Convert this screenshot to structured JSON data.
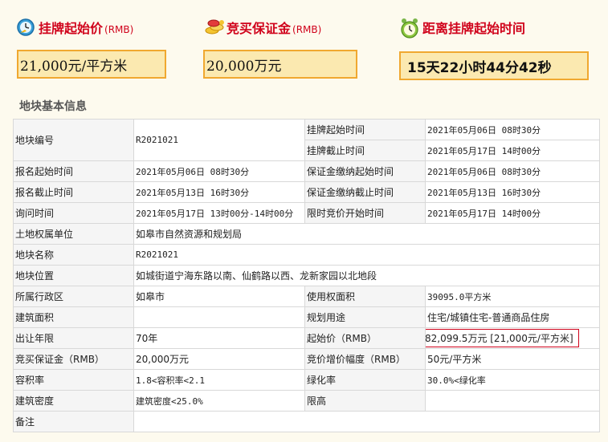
{
  "header": {
    "start_price": {
      "title": "挂牌起始价",
      "unit": "(RMB)",
      "value": "21,000元/平方米",
      "icon": "clock-icon"
    },
    "deposit": {
      "title": "竞买保证金",
      "unit": "(RMB)",
      "value": "20,000万元",
      "icon": "coins-icon"
    },
    "countdown": {
      "title": "距离挂牌起始时间",
      "value": "15天22小时44分42秒",
      "icon": "alarm-clock-icon"
    }
  },
  "section_title": "地块基本信息",
  "rows": {
    "r1": {
      "l1": "地块编号",
      "v1": "R2021021",
      "l2": "挂牌起始时间",
      "v2": "2021年05月06日 08时30分"
    },
    "r1b": {
      "l2": "挂牌截止时间",
      "v2": "2021年05月17日 14时00分"
    },
    "r2": {
      "l1": "报名起始时间",
      "v1": "2021年05月06日 08时30分",
      "l2": "保证金缴纳起始时间",
      "v2": "2021年05月06日 08时30分"
    },
    "r3": {
      "l1": "报名截止时间",
      "v1": "2021年05月13日 16时30分",
      "l2": "保证金缴纳截止时间",
      "v2": "2021年05月13日 16时30分"
    },
    "r4": {
      "l1": "询问时间",
      "v1": "2021年05月17日 13时00分-14时00分",
      "l2": "限时竞价开始时间",
      "v2": "2021年05月17日 14时00分"
    },
    "r5": {
      "l1": "土地权属单位",
      "v1": "如皋市自然资源和规划局"
    },
    "r6": {
      "l1": "地块名称",
      "v1": "R2021021"
    },
    "r7": {
      "l1": "地块位置",
      "v1": "如城街道宁海东路以南、仙鹤路以西、龙新家园以北地段"
    },
    "r8": {
      "l1": "所属行政区",
      "v1": "如皋市",
      "l2": "使用权面积",
      "v2": "39095.0平方米"
    },
    "r9": {
      "l1": "建筑面积",
      "v1": "",
      "l2": "规划用途",
      "v2": "住宅/城镇住宅-普通商品住房"
    },
    "r10": {
      "l1": "出让年限",
      "v1": "70年",
      "l2": "起始价（RMB）",
      "v2": "82,099.5万元 [21,000元/平方米]"
    },
    "r11": {
      "l1": "竞买保证金（RMB）",
      "v1": "20,000万元",
      "l2": "竞价增价幅度（RMB）",
      "v2": "50元/平方米"
    },
    "r12": {
      "l1": "容积率",
      "v1": "1.8<容积率<2.1",
      "l2": "绿化率",
      "v2": "30.0%<绿化率"
    },
    "r13": {
      "l1": "建筑密度",
      "v1": "建筑密度<25.0%",
      "l2": "限高",
      "v2": ""
    },
    "r14": {
      "l1": "备注",
      "v1": ""
    }
  }
}
